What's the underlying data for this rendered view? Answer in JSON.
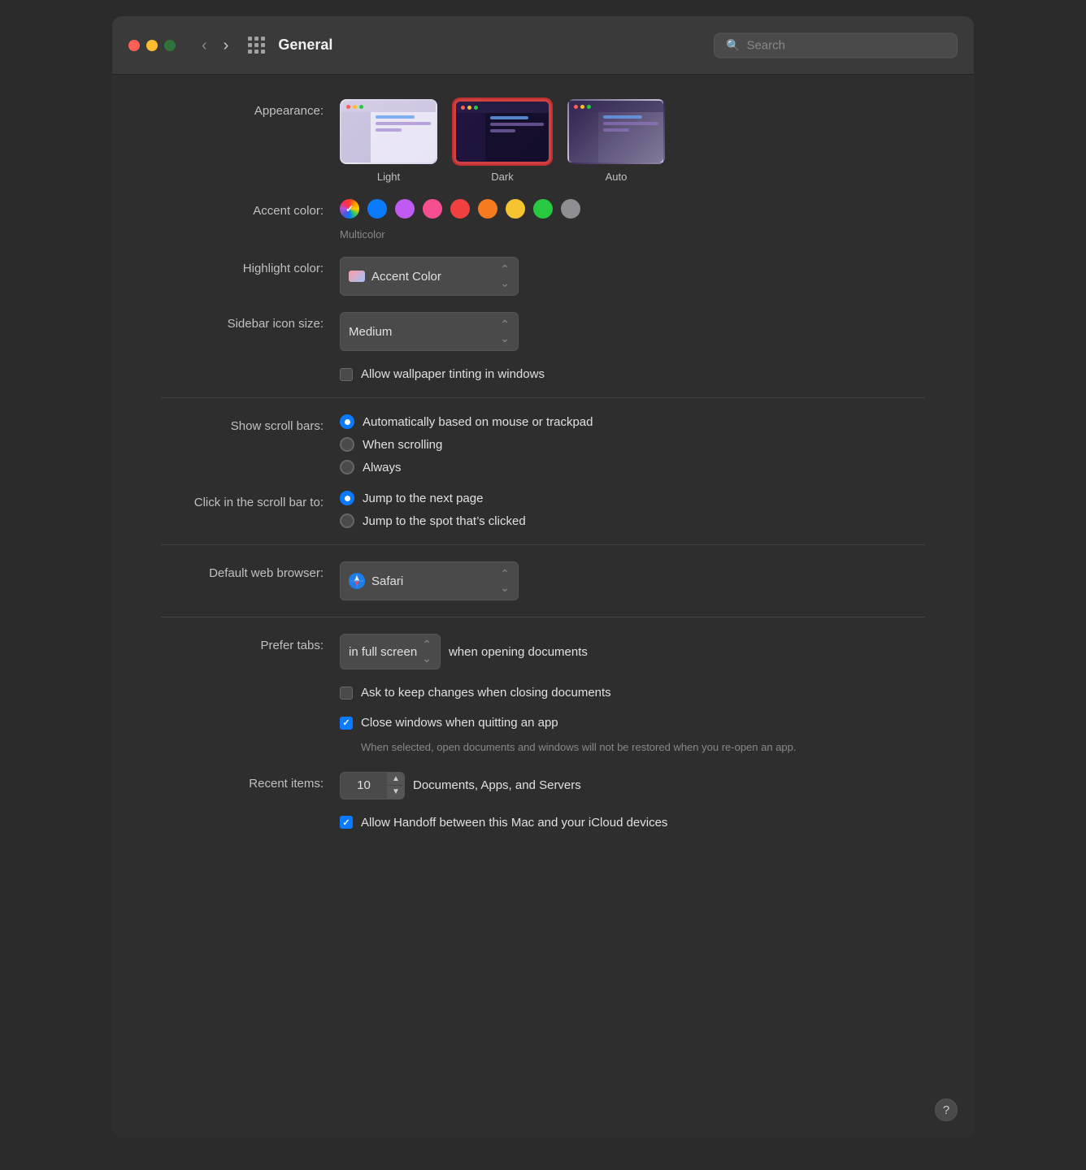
{
  "window": {
    "title": "General",
    "search_placeholder": "Search"
  },
  "appearance": {
    "label": "Appearance:",
    "options": [
      {
        "id": "light",
        "label": "Light",
        "selected": false
      },
      {
        "id": "dark",
        "label": "Dark",
        "selected": true
      },
      {
        "id": "auto",
        "label": "Auto",
        "selected": false
      }
    ]
  },
  "accent_color": {
    "label": "Accent color:",
    "colors": [
      {
        "name": "multicolor",
        "color": "multicolor",
        "label": "Multicolor",
        "selected": true
      },
      {
        "name": "blue",
        "color": "#0a7aff",
        "selected": false
      },
      {
        "name": "purple",
        "color": "#bf5af2",
        "selected": false
      },
      {
        "name": "pink",
        "color": "#f64f91",
        "selected": false
      },
      {
        "name": "red",
        "color": "#f04040",
        "selected": false
      },
      {
        "name": "orange",
        "color": "#f57a20",
        "selected": false
      },
      {
        "name": "yellow",
        "color": "#f5c430",
        "selected": false
      },
      {
        "name": "green",
        "color": "#28c840",
        "selected": false
      },
      {
        "name": "graphite",
        "color": "#8e8e93",
        "selected": false
      }
    ],
    "multicolor_label": "Multicolor"
  },
  "highlight_color": {
    "label": "Highlight color:",
    "value": "Accent Color"
  },
  "sidebar_icon_size": {
    "label": "Sidebar icon size:",
    "value": "Medium"
  },
  "wallpaper_tinting": {
    "label": "",
    "text": "Allow wallpaper tinting in windows",
    "checked": false
  },
  "show_scroll_bars": {
    "label": "Show scroll bars:",
    "options": [
      {
        "id": "auto",
        "label": "Automatically based on mouse or trackpad",
        "selected": true
      },
      {
        "id": "scrolling",
        "label": "When scrolling",
        "selected": false
      },
      {
        "id": "always",
        "label": "Always",
        "selected": false
      }
    ]
  },
  "click_scroll_bar": {
    "label": "Click in the scroll bar to:",
    "options": [
      {
        "id": "next-page",
        "label": "Jump to the next page",
        "selected": true
      },
      {
        "id": "spot",
        "label": "Jump to the spot that’s clicked",
        "selected": false
      }
    ]
  },
  "default_browser": {
    "label": "Default web browser:",
    "value": "Safari"
  },
  "prefer_tabs": {
    "label": "Prefer tabs:",
    "value": "in full screen",
    "suffix": "when opening documents"
  },
  "keep_changes": {
    "text": "Ask to keep changes when closing documents",
    "checked": false
  },
  "close_windows": {
    "text": "Close windows when quitting an app",
    "checked": true,
    "subtext": "When selected, open documents and windows will not be restored when you re-open an app."
  },
  "recent_items": {
    "label": "Recent items:",
    "value": "10",
    "suffix": "Documents, Apps, and Servers"
  },
  "handoff": {
    "text": "Allow Handoff between this Mac and your iCloud devices",
    "checked": true
  },
  "help": {
    "label": "?"
  }
}
